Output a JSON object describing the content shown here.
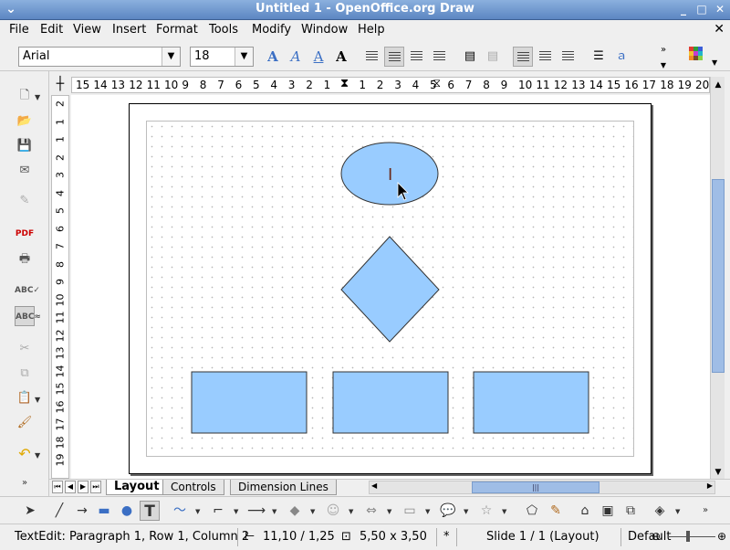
{
  "window": {
    "title": "Untitled 1 - OpenOffice.org Draw",
    "minimize": "_",
    "maximize": "□",
    "close": "✕"
  },
  "menu": [
    "File",
    "Edit",
    "View",
    "Insert",
    "Format",
    "Tools",
    "Modify",
    "Window",
    "Help"
  ],
  "formatting": {
    "font_name": "Arial",
    "font_size": "18"
  },
  "ruler": {
    "horizontal": [
      "15",
      "14",
      "13",
      "12",
      "11",
      "10",
      "9",
      "8",
      "7",
      "6",
      "5",
      "4",
      "3",
      "2",
      "1",
      "",
      "1",
      "2",
      "3",
      "4",
      "5",
      "6",
      "7",
      "8",
      "9",
      "10",
      "11",
      "12",
      "13",
      "14",
      "15",
      "16",
      "17",
      "18",
      "19",
      "20"
    ],
    "vertical": [
      "2",
      "1",
      "1",
      "2",
      "3",
      "4",
      "5",
      "6",
      "7",
      "8",
      "9",
      "10",
      "11",
      "12",
      "13",
      "14",
      "15",
      "16",
      "17",
      "18",
      "19"
    ]
  },
  "shapes": {
    "fill": "#99ccff",
    "stroke": "#333333",
    "text_cursor": "I"
  },
  "tabs": [
    "Layout",
    "Controls",
    "Dimension Lines"
  ],
  "status": {
    "edit": "TextEdit: Paragraph 1, Row 1, Column 2",
    "position": "11,10 / 1,25",
    "size": "5,50 x 3,50",
    "modified": "*",
    "slide": "Slide 1 / 1 (Layout)",
    "style": "Default"
  },
  "colors": {
    "titlebar": "#6f97d0",
    "accent": "#9fbde6"
  }
}
